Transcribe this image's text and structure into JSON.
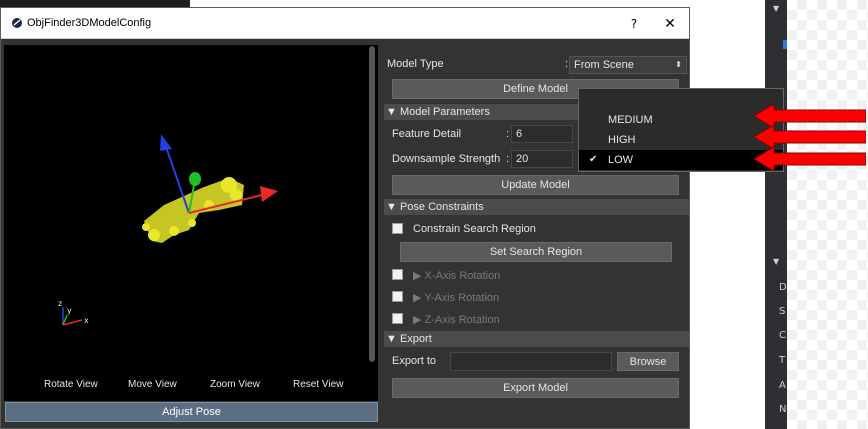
{
  "window": {
    "title": "ObjFinder3DModelConfig",
    "help_label": "?",
    "close_label": "✕"
  },
  "viewport": {
    "buttons": [
      "Rotate View",
      "Move View",
      "Zoom View",
      "Reset View"
    ],
    "adjust_pose_label": "Adjust Pose",
    "axis_gizmo": {
      "z": "z",
      "y": "y",
      "x": "x"
    }
  },
  "panel": {
    "model_type_label": "Model Type",
    "model_type_colon": ":",
    "model_type_value": "From Scene",
    "define_model_label": "Define Model",
    "model_parameters_label": "Model Parameters",
    "feature_detail_label": "Feature Detail",
    "feature_detail_colon": ":",
    "feature_detail_value": "6",
    "downsample_label": "Downsample Strength",
    "downsample_colon": ":",
    "downsample_value": "20",
    "update_model_label": "Update Model",
    "pose_constraints_label": "Pose Constraints",
    "constrain_search_label": "Constrain Search Region",
    "set_search_region_label": "Set Search Region",
    "x_axis_label": "X-Axis Rotation",
    "y_axis_label": "Y-Axis Rotation",
    "z_axis_label": "Z-Axis Rotation",
    "export_section_label": "Export",
    "export_to_label": "Export to",
    "export_to_value": "",
    "browse_label": "Browse",
    "export_model_label": "Export Model"
  },
  "dropdown": {
    "options": [
      "MEDIUM",
      "HIGH",
      "LOW"
    ],
    "selected": "LOW"
  },
  "colors": {
    "arrow_red": "#ff0000",
    "x_axis": "#e8282a",
    "y_axis": "#22c022",
    "z_axis": "#2340e0",
    "point_cloud": "#e8e82a"
  },
  "background_letters": [
    "D",
    "S",
    "C",
    "T",
    "A",
    "N"
  ]
}
